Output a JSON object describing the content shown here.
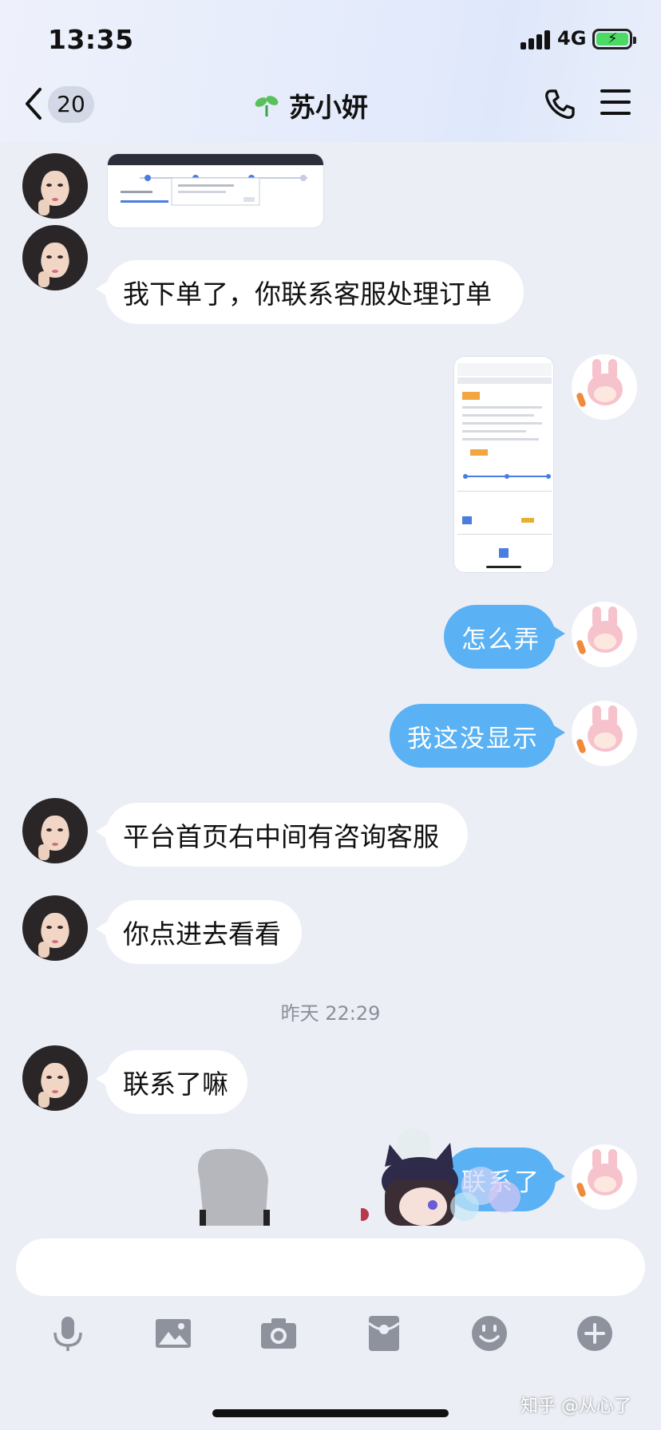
{
  "status_bar": {
    "time": "13:35",
    "network": "4G"
  },
  "header": {
    "unread_count": "20",
    "contact_name": "苏小妍"
  },
  "messages": [
    {
      "type": "image",
      "sender": "contact"
    },
    {
      "type": "text",
      "sender": "contact",
      "text": "我下单了，你联系客服处理订单"
    },
    {
      "type": "image",
      "sender": "me"
    },
    {
      "type": "text",
      "sender": "me",
      "text": "怎么弄"
    },
    {
      "type": "text",
      "sender": "me",
      "text": "我这没显示"
    },
    {
      "type": "text",
      "sender": "contact",
      "text": "平台首页右中间有咨询客服"
    },
    {
      "type": "text",
      "sender": "contact",
      "text": "你点进去看看"
    },
    {
      "type": "time",
      "text": "昨天 22:29"
    },
    {
      "type": "text",
      "sender": "contact",
      "text": "联系了嘛"
    },
    {
      "type": "text",
      "sender": "me",
      "text": "联系了"
    }
  ],
  "toolbar_icons": [
    "microphone-icon",
    "image-icon",
    "camera-icon",
    "red-packet-icon",
    "emoji-icon",
    "plus-icon"
  ],
  "watermark": "知乎 @从心了",
  "colors": {
    "bubble_out": "#5ab1f4",
    "bubble_in": "#ffffff",
    "background": "#eceef6"
  }
}
